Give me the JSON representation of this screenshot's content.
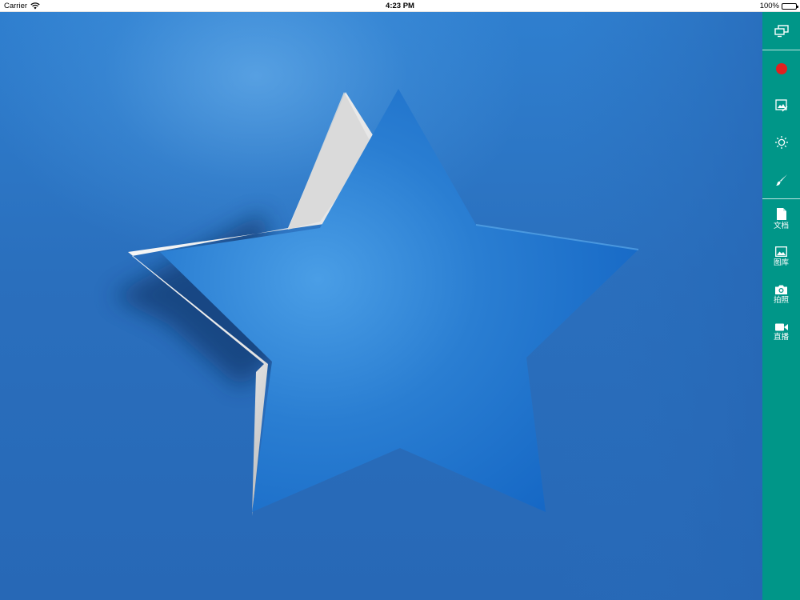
{
  "status_bar": {
    "carrier": "Carrier",
    "time": "4:23 PM",
    "battery": "100%"
  },
  "toolbar": {
    "background": "#009688",
    "record_color": "#e02020",
    "top_icons": [
      "screen-mirror-icon",
      "record-icon",
      "image-annotate-icon",
      "brightness-icon",
      "brush-icon"
    ],
    "items": [
      {
        "icon": "document-icon",
        "label": "文档"
      },
      {
        "icon": "image-gallery-icon",
        "label": "图库"
      },
      {
        "icon": "camera-icon",
        "label": "拍照"
      },
      {
        "icon": "video-camera-icon",
        "label": "直播"
      }
    ]
  },
  "canvas": {
    "background_color": "#2a6fbd",
    "star_color": "#1f72c9"
  }
}
